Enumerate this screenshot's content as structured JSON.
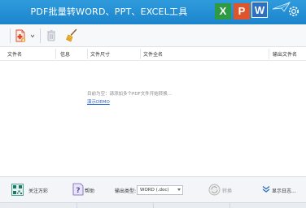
{
  "window": {
    "title": "PDF批量转WORD、PPT、EXCEL工具",
    "badges": [
      "X",
      "P",
      "W"
    ]
  },
  "toolbar": {
    "add_icon": "add-pdf-icon",
    "dropdown_icon": "chevron-down-icon",
    "delete_icon": "trash-icon",
    "clear_icon": "broom-icon"
  },
  "table": {
    "columns": [
      "文件名",
      "信息",
      "文件尺寸",
      "文件全名",
      "输出文件名"
    ],
    "empty_hint": "目前为空：请添加多个PDF文件开始转换...",
    "demo_link": "演示DEMO"
  },
  "bottom": {
    "follow_label": "关注万彩",
    "help_label": "帮助",
    "output_type_label": "输出类型:",
    "output_type_value": "WORD (.doc)",
    "convert_label": "转换",
    "log_label": "显示日志..."
  },
  "colors": {
    "title_bar": "#1c84cc",
    "excel": "#2e9a43",
    "ppt": "#e0542c",
    "word": "#2d6fc0",
    "link": "#2a66c9"
  }
}
